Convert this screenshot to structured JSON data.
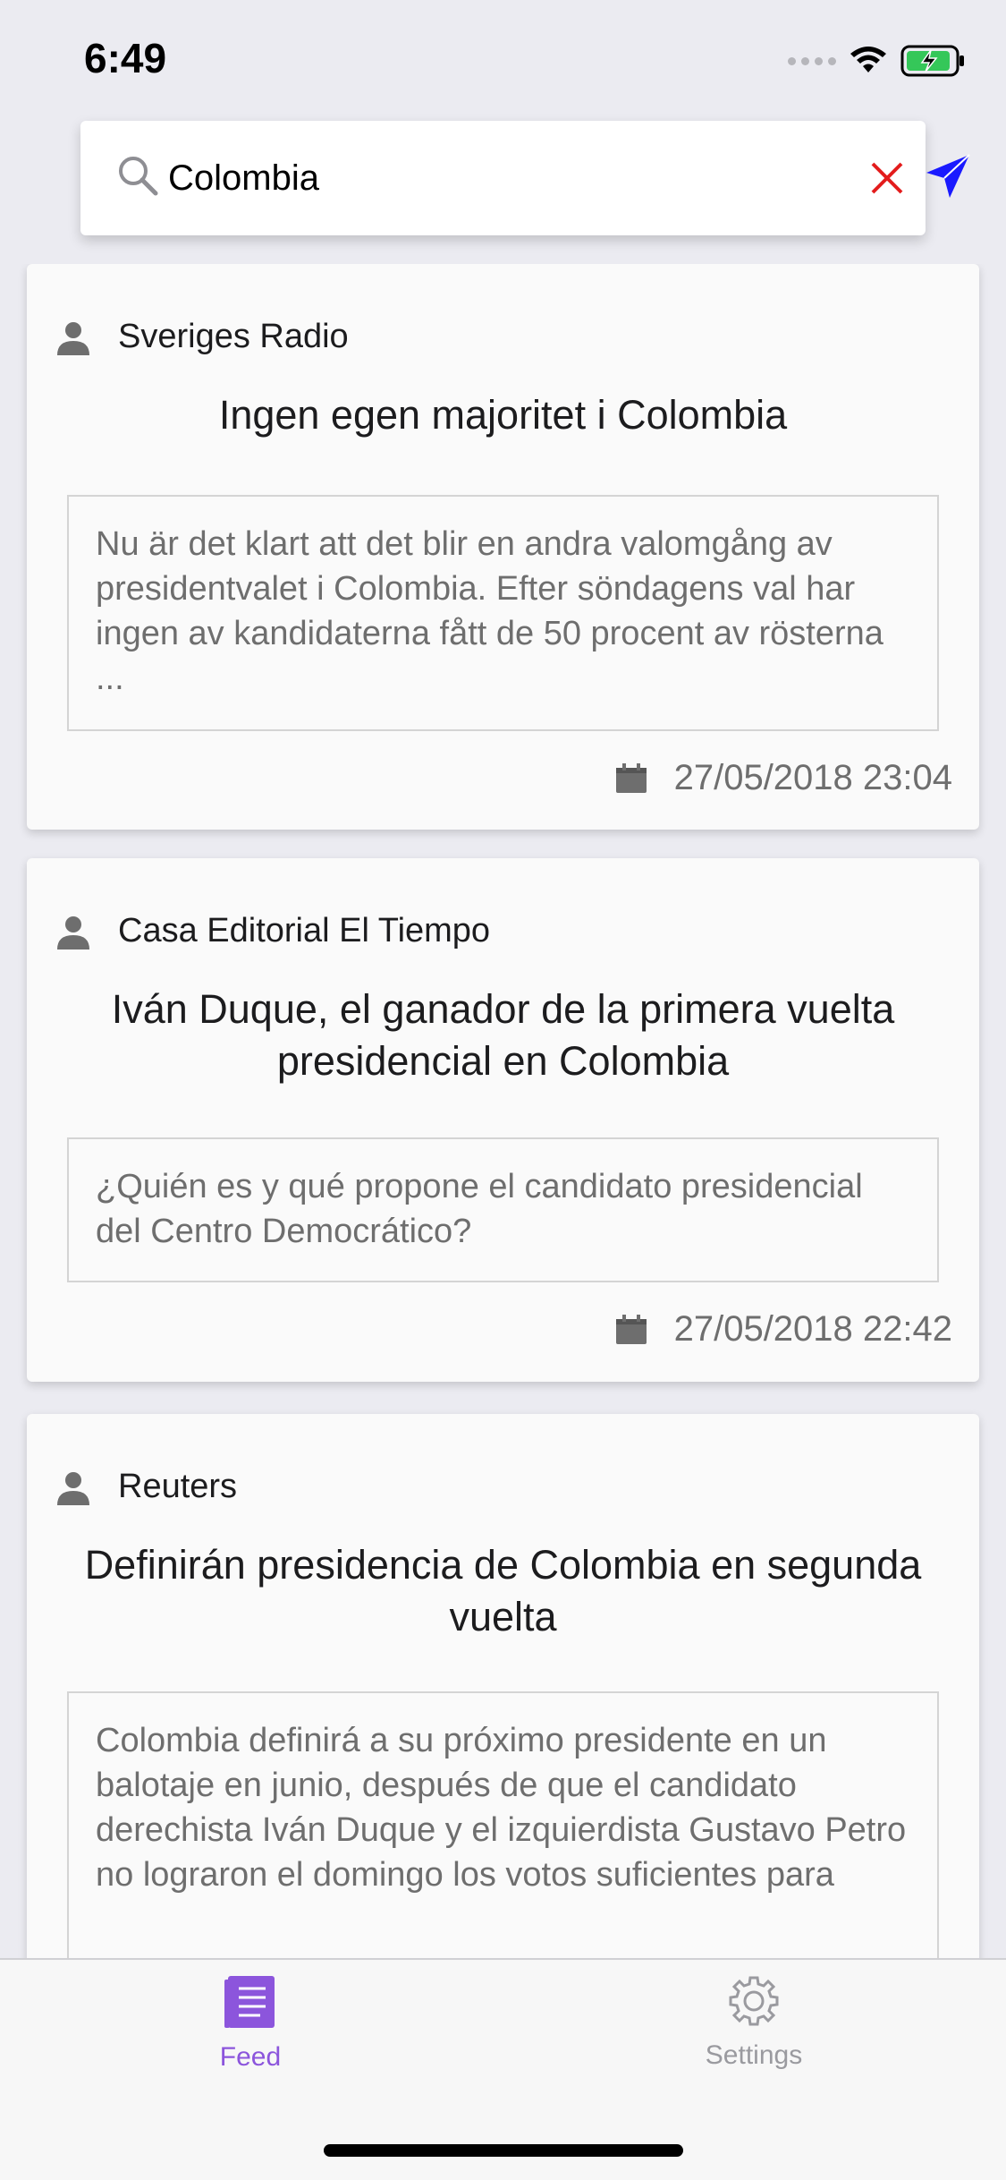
{
  "status_bar": {
    "time": "6:49"
  },
  "search": {
    "value": "Colombia",
    "placeholder": ""
  },
  "feed": {
    "items": [
      {
        "source": "Sveriges Radio",
        "title": "Ingen egen majoritet i Colombia",
        "summary": "Nu är det klart att det blir en andra valomgång av presidentvalet i Colombia. Efter söndagens val har ingen av kandidaterna fått de 50 procent av rösterna ...",
        "date": "27/05/2018 23:04"
      },
      {
        "source": "Casa Editorial El Tiempo",
        "title": "Iván Duque, el ganador de la primera vuelta presidencial en Colombia",
        "summary": "¿Quién es y qué propone el candidato presidencial del Centro Democrático?",
        "date": "27/05/2018 22:42"
      },
      {
        "source": "Reuters",
        "title": "Definirán presidencia de Colombia en segunda vuelta",
        "summary": "Colombia definirá a su próximo presidente en un balotaje en junio, después de que el candidato derechista Iván Duque y el izquierdista Gustavo Petro no lograron el domingo los votos suficientes para",
        "date": ""
      }
    ]
  },
  "tab_bar": {
    "tabs": [
      {
        "label": "Feed",
        "icon": "feed-icon",
        "active": true
      },
      {
        "label": "Settings",
        "icon": "gear-icon",
        "active": false
      }
    ]
  },
  "colors": {
    "accent": "#8c55dc",
    "send": "#1a1aff",
    "clear": "#e31c1c",
    "background": "#ebebf1"
  }
}
